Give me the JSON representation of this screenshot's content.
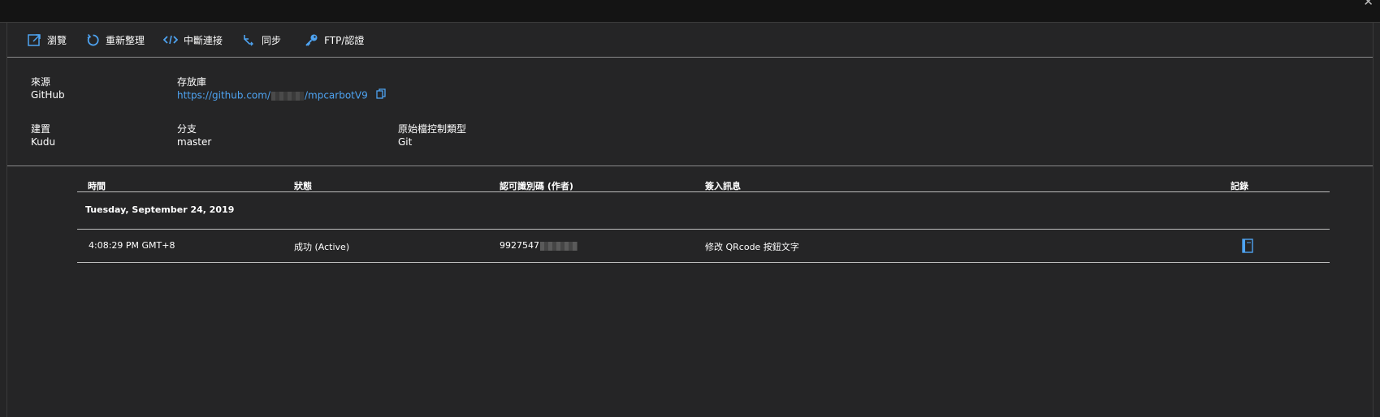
{
  "toolbar": {
    "browse_label": "瀏覽",
    "refresh_label": "重新整理",
    "disconnect_label": "中斷連接",
    "sync_label": "同步",
    "ftp_label": "FTP/認證"
  },
  "properties": {
    "source": {
      "label": "來源",
      "value": "GitHub"
    },
    "repository": {
      "label": "存放庫",
      "value_prefix": "https://github.com/",
      "value_suffix": "/mpcarbotV9"
    },
    "build": {
      "label": "建置",
      "value": "Kudu"
    },
    "branch": {
      "label": "分支",
      "value": "master"
    },
    "scm_type": {
      "label": "原始檔控制類型",
      "value": "Git"
    }
  },
  "table": {
    "columns": {
      "time": "時間",
      "status": "狀態",
      "commit_id": "認可識別碼 (作者)",
      "checkin_message": "簽入訊息",
      "log": "記錄"
    },
    "group_label": "Tuesday, September 24, 2019",
    "rows": [
      {
        "time": "4:08:29 PM GMT+8",
        "status": "成功 (Active)",
        "commit_id_visible": "9927547",
        "message": "修改 QRcode 按鈕文字"
      }
    ]
  },
  "colors": {
    "accent": "#4ea3f1",
    "background": "#252526",
    "topbar": "#141414"
  }
}
